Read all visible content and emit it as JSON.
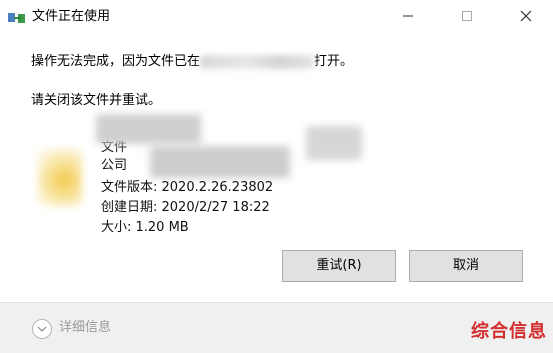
{
  "window": {
    "title": "文件正在使用"
  },
  "message": {
    "line1_prefix": "操作无法完成，因为文件已在",
    "line1_suffix": "打开。",
    "line2": "请关闭该文件并重试。"
  },
  "file_info": {
    "type_label": "文件",
    "company_label": "公司",
    "version": "文件版本: 2020.2.26.23802",
    "created": "创建日期: 2020/2/27 18:22",
    "size": "大小: 1.20 MB"
  },
  "buttons": {
    "retry": "重试(R)",
    "cancel": "取消"
  },
  "footer": {
    "details": "详细信息",
    "watermark": "综合信息"
  },
  "colors": {
    "button_bg": "#e1e1e1",
    "footer_bg": "#f0f0f0",
    "watermark": "#d32f2f"
  }
}
